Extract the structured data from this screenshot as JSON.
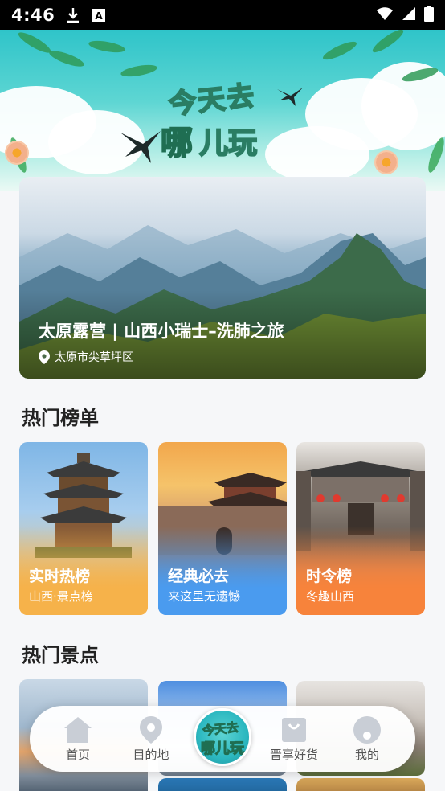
{
  "status_bar": {
    "time": "4:46",
    "icons": [
      "download-icon",
      "a-square-icon",
      "wifi-icon",
      "signal-icon",
      "battery-icon"
    ]
  },
  "header": {
    "logo_line1": "今天去",
    "logo_line2": "哪",
    "logo_line3": "儿玩"
  },
  "featured": {
    "title": "太原露营 | 山西小瑞士–洗肺之旅",
    "location": "太原市尖草坪区"
  },
  "hot_list": {
    "title": "热门榜单",
    "cards": [
      {
        "title": "实时热榜",
        "subtitle": "山西·景点榜",
        "accent": "#f6b24a"
      },
      {
        "title": "经典必去",
        "subtitle": "来这里无遗憾",
        "accent": "#4a9bef"
      },
      {
        "title": "时令榜",
        "subtitle": "冬趣山西",
        "accent": "#f7833b"
      }
    ]
  },
  "hot_spots": {
    "title": "热门景点"
  },
  "bottom_nav": {
    "items": [
      {
        "label": "首页",
        "icon": "home-icon"
      },
      {
        "label": "目的地",
        "icon": "location-pin-icon"
      },
      {
        "label": "晋享好货",
        "icon": "shopping-bag-icon"
      },
      {
        "label": "我的",
        "icon": "profile-icon"
      }
    ],
    "center_line1": "今天去",
    "center_line2": "哪儿玩"
  }
}
